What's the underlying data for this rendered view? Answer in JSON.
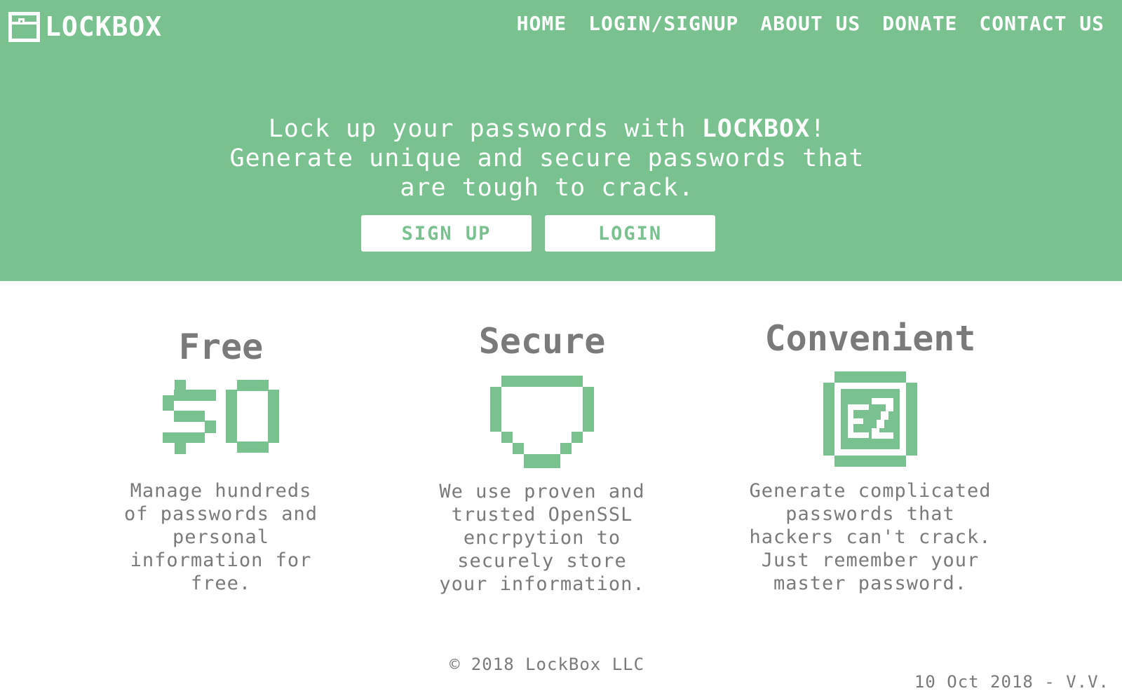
{
  "colors": {
    "brand_green": "#79c290",
    "text_gray": "#7a7a7a",
    "white": "#ffffff"
  },
  "header": {
    "logo_icon": "lockbox-icon",
    "logo_text": "LOCKBOX",
    "nav": [
      {
        "label": "HOME"
      },
      {
        "label": "LOGIN/SIGNUP"
      },
      {
        "label": "ABOUT US"
      },
      {
        "label": "DONATE"
      },
      {
        "label": "CONTACT US"
      }
    ]
  },
  "hero": {
    "tagline_prefix": "Lock up your passwords with ",
    "tagline_brand": "LOCKBOX",
    "tagline_suffix": "!",
    "tagline_line2": "Generate unique and secure passwords that are tough to crack.",
    "signup_label": "SIGN UP",
    "login_label": "LOGIN"
  },
  "features": [
    {
      "title": "Free",
      "icon": "dollar-zero-icon",
      "text": "Manage hundreds of passwords and personal information for free."
    },
    {
      "title": "Secure",
      "icon": "shield-icon",
      "text": "We use proven and trusted OpenSSL encrpytion to securely store your information."
    },
    {
      "title": "Convenient",
      "icon": "ez-icon",
      "text": "Generate complicated passwords that hackers can't crack. Just remember your master password."
    }
  ],
  "footer": {
    "copyright": "© 2018 LockBox LLC",
    "date_stamp": "10 Oct 2018 - V.V."
  }
}
